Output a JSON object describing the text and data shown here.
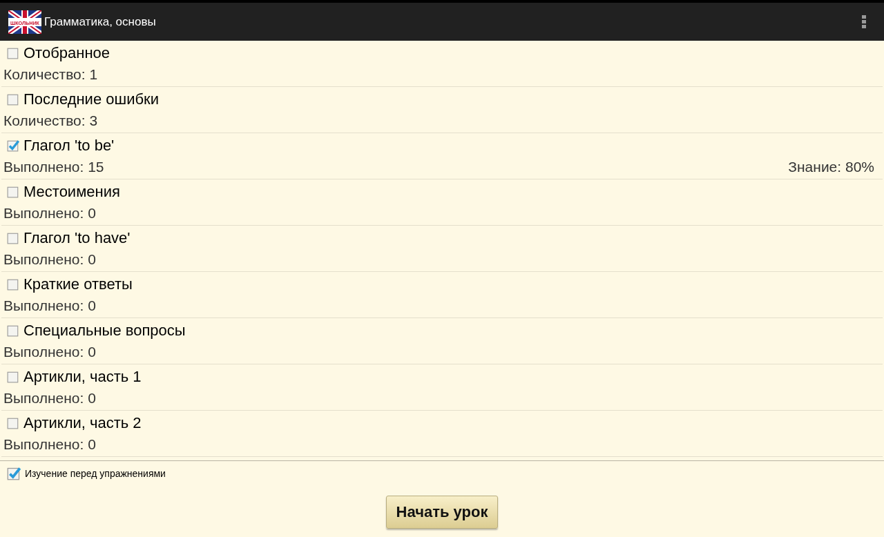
{
  "app_bar": {
    "logo_text": "ШКОЛЬНИК",
    "title": "Грамматика, основы"
  },
  "lessons": [
    {
      "title": "Отобранное",
      "checked": false,
      "info": "Количество: 1"
    },
    {
      "title": "Последние ошибки",
      "checked": false,
      "info": "Количество: 3"
    },
    {
      "title": "Глагол 'to be'",
      "checked": true,
      "info": "Выполнено: 15",
      "knowledge": "Знание: 80%"
    },
    {
      "title": "Местоимения",
      "checked": false,
      "info": "Выполнено: 0"
    },
    {
      "title": "Глагол 'to have'",
      "checked": false,
      "info": "Выполнено: 0"
    },
    {
      "title": "Краткие ответы",
      "checked": false,
      "info": "Выполнено: 0"
    },
    {
      "title": "Специальные вопросы",
      "checked": false,
      "info": "Выполнено: 0"
    },
    {
      "title": "Артикли, часть 1",
      "checked": false,
      "info": "Выполнено: 0"
    },
    {
      "title": "Артикли, часть 2",
      "checked": false,
      "info": "Выполнено: 0"
    }
  ],
  "study_option": {
    "label": "Изучение перед упражнениями",
    "checked": true
  },
  "start_button": "Начать урок"
}
